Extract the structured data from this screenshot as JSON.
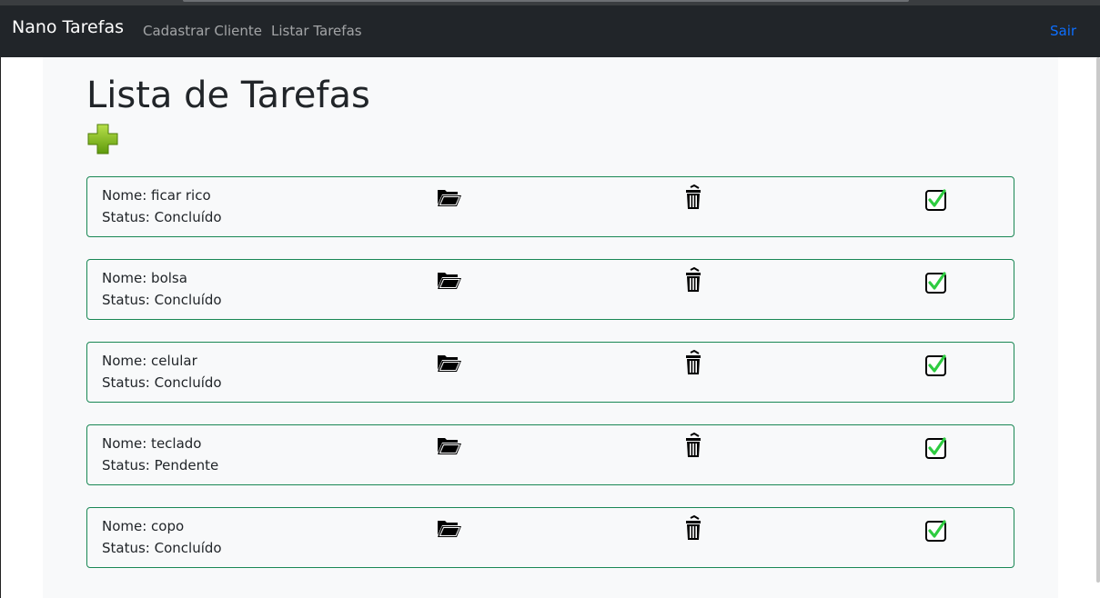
{
  "navbar": {
    "brand": "Nano Tarefas",
    "links": [
      "Cadastrar Cliente",
      "Listar Tarefas"
    ],
    "logout": "Sair"
  },
  "page": {
    "title": "Lista de Tarefas"
  },
  "tasks": [
    {
      "name_line": "Nome: ficar rico",
      "status_line": "Status: Concluído"
    },
    {
      "name_line": "Nome: bolsa",
      "status_line": "Status: Concluído"
    },
    {
      "name_line": "Nome: celular",
      "status_line": "Status: Concluído"
    },
    {
      "name_line": "Nome: teclado",
      "status_line": "Status: Pendente"
    },
    {
      "name_line": "Nome: copo",
      "status_line": "Status: Concluído"
    }
  ],
  "icons": {
    "add": "plus-icon",
    "open": "folder-open-icon",
    "delete": "trash-icon",
    "complete": "checkbox-checked-icon"
  },
  "colors": {
    "navbar_bg": "#212529",
    "card_border": "#198754",
    "logout_link": "#0d6efd",
    "plus_green": "#7cb518",
    "check_green": "#2ecc40"
  }
}
